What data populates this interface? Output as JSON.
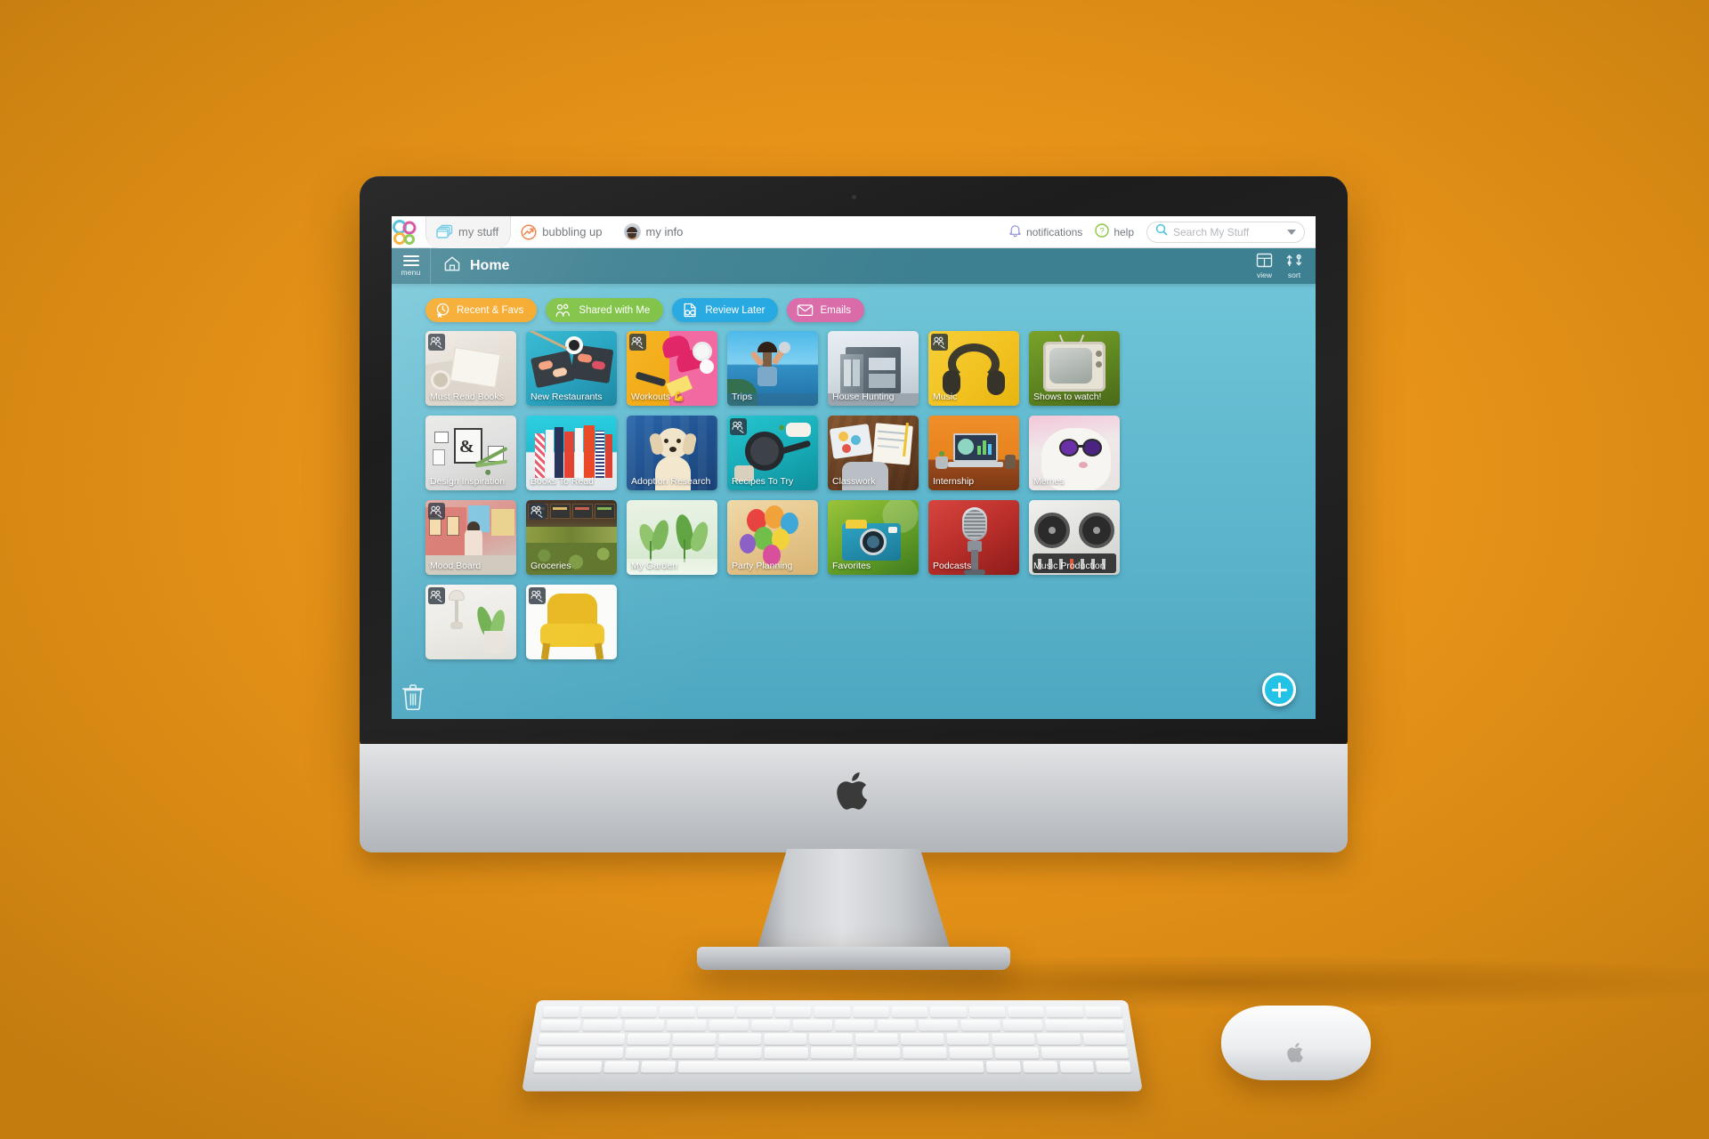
{
  "topbar": {
    "tabs": [
      {
        "label": "my stuff",
        "icon": "folders-icon",
        "active": true
      },
      {
        "label": "bubbling up",
        "icon": "trending-up-icon",
        "active": false
      },
      {
        "label": "my info",
        "icon": "avatar-icon",
        "active": false
      }
    ],
    "notifications_label": "notifications",
    "help_label": "help",
    "search_placeholder": "Search My Stuff",
    "search_value": ""
  },
  "header": {
    "menu_label": "menu",
    "title": "Home",
    "view_label": "view",
    "sort_label": "sort"
  },
  "filters": [
    {
      "label": "Recent & Favs",
      "icon": "clock-star-icon",
      "color": "#f5a623"
    },
    {
      "label": "Shared with Me",
      "icon": "people-icon",
      "color": "#7dc242"
    },
    {
      "label": "Review Later",
      "icon": "document-glasses-icon",
      "color": "#22a7e0"
    },
    {
      "label": "Emails",
      "icon": "envelope-icon",
      "color": "#d96aa8"
    }
  ],
  "tiles": [
    {
      "label": "Must Read Books",
      "shared": true,
      "art": "books-bed"
    },
    {
      "label": "New Restaurants",
      "shared": false,
      "art": "sushi"
    },
    {
      "label": "Workouts 💪",
      "shared": true,
      "art": "sneakers"
    },
    {
      "label": "Trips",
      "shared": false,
      "art": "beach"
    },
    {
      "label": "House Hunting",
      "shared": false,
      "art": "modern-house"
    },
    {
      "label": "Music",
      "shared": true,
      "art": "headphones"
    },
    {
      "label": "Shows to watch!",
      "shared": false,
      "art": "retro-tv"
    },
    {
      "label": "Design Inspiration",
      "shared": false,
      "art": "gallery-wall"
    },
    {
      "label": "Books To Read",
      "shared": false,
      "art": "book-spines"
    },
    {
      "label": "Adoption Research",
      "shared": false,
      "art": "puppy"
    },
    {
      "label": "Recipes To Try",
      "shared": true,
      "art": "skillet"
    },
    {
      "label": "Classwork",
      "shared": false,
      "art": "desk-notebook"
    },
    {
      "label": "Internship",
      "shared": false,
      "art": "laptop-desk"
    },
    {
      "label": "Memes",
      "shared": false,
      "art": "cat-sunglasses"
    },
    {
      "label": "Mood Board",
      "shared": true,
      "art": "street-bike"
    },
    {
      "label": "Groceries",
      "shared": true,
      "art": "market"
    },
    {
      "label": "My Garden",
      "shared": false,
      "art": "seedlings"
    },
    {
      "label": "Party Planning",
      "shared": false,
      "art": "balloons"
    },
    {
      "label": "Favorites",
      "shared": false,
      "art": "camera"
    },
    {
      "label": "Podcasts",
      "shared": false,
      "art": "microphone"
    },
    {
      "label": "Music Production",
      "shared": false,
      "art": "mixer"
    },
    {
      "label": "",
      "shared": true,
      "art": "lamp-plant"
    },
    {
      "label": "",
      "shared": true,
      "art": "yellow-chair"
    }
  ],
  "board": {
    "trash_icon": "trash-icon",
    "add_icon": "plus-icon"
  }
}
